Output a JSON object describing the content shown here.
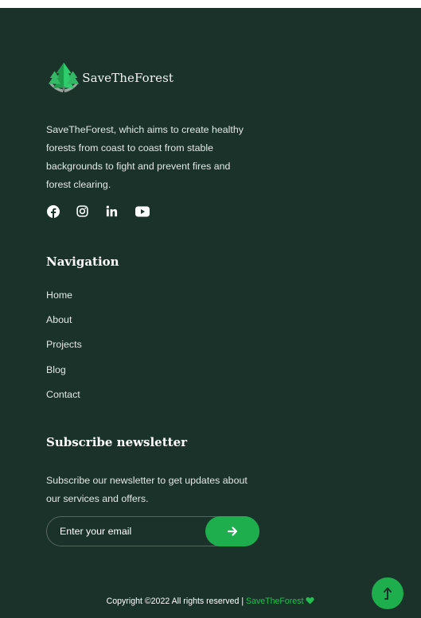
{
  "brand": {
    "name": "SaveTheForest",
    "logo_icon": "tree-hands-logo"
  },
  "about": {
    "text": "SaveTheForest, which aims to create healthy forests from coast to coast from stable backgrounds to fight and prevent fires and forest clearing."
  },
  "social": [
    {
      "name": "facebook-icon"
    },
    {
      "name": "instagram-icon"
    },
    {
      "name": "linkedin-icon"
    },
    {
      "name": "youtube-icon"
    }
  ],
  "navigation": {
    "title": "Navigation",
    "items": [
      {
        "label": "Home"
      },
      {
        "label": "About"
      },
      {
        "label": "Projects"
      },
      {
        "label": "Blog"
      },
      {
        "label": "Contact"
      }
    ]
  },
  "newsletter": {
    "title": "Subscribe newsletter",
    "text": "Subscribe our newsletter to get updates about our services and offers.",
    "placeholder": "Enter your email",
    "submit_icon": "arrow-right-icon"
  },
  "copyright": {
    "prefix": "Copyright ©2022 All rights reserved | ",
    "brand": "SaveTheForest",
    "icon": "heart-icon"
  },
  "back_to_top": {
    "icon": "arrow-up-icon"
  },
  "colors": {
    "background": "#1b322b",
    "accent": "#1eae4d",
    "text": "#e2e8e5"
  }
}
